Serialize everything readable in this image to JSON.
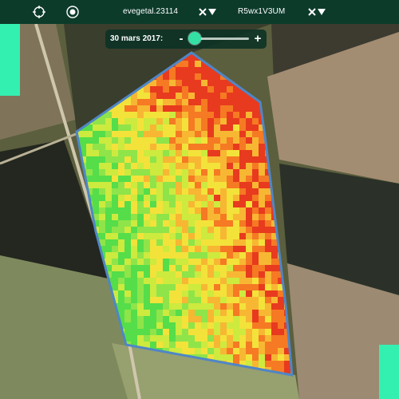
{
  "toolbar": {
    "tools": [
      {
        "icon": "crosshair-icon"
      },
      {
        "icon": "target-icon"
      }
    ],
    "layers": [
      {
        "label": "evegetal.23114",
        "remove_icon": "close-icon",
        "menu_icon": "dropdown-icon"
      },
      {
        "label": "R5wx1V3UM",
        "remove_icon": "close-icon",
        "menu_icon": "dropdown-icon"
      }
    ]
  },
  "timeline": {
    "date_label": "30 mars 2017:",
    "decrement_label": "-",
    "increment_label": "+",
    "position": 0.05
  },
  "map": {
    "field_outline_color": "#4f86c6",
    "ndvi_colors": [
      "#e83a1e",
      "#f57a23",
      "#f7b733",
      "#f3e23a",
      "#cdea3f",
      "#8fe449",
      "#55dd4a"
    ]
  },
  "accents": {
    "color": "#33f0b0"
  }
}
